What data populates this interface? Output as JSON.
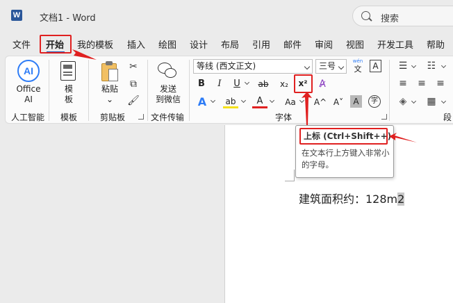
{
  "window": {
    "title": "文档1  -  Word",
    "logo": "W"
  },
  "search": {
    "label": "搜索"
  },
  "tabs": [
    "文件",
    "开始",
    "我的模板",
    "插入",
    "绘图",
    "设计",
    "布局",
    "引用",
    "邮件",
    "审阅",
    "视图",
    "开发工具",
    "帮助"
  ],
  "ribbon": {
    "office_ai": {
      "icon_text": "AI",
      "label_line1": "Office",
      "label_line2": "AI",
      "group": "人工智能"
    },
    "template": {
      "label_line1": "模",
      "label_line2": "板",
      "group": "模板"
    },
    "clipboard": {
      "paste_line1": "粘贴",
      "paste_arrow": "⌄",
      "group": "剪贴板"
    },
    "transfer": {
      "label_line1": "发送",
      "label_line2": "到微信",
      "group": "文件传输"
    },
    "font": {
      "font_name": "等线 (西文正文)",
      "font_size": "三号",
      "wen_top": "wén",
      "wen_char": "文",
      "bold": "B",
      "italic": "I",
      "underline": "U",
      "strike": "ab",
      "subscript": "x₂",
      "superscript": "x²",
      "text_effect": "A",
      "highlight": "ab",
      "font_color": "A",
      "change_case": "Aa",
      "grow": "A^",
      "shrink": "A˅",
      "clear": "A",
      "shade": "A",
      "enclose": "字",
      "group": "字体"
    },
    "paragraph": {
      "group": "段"
    }
  },
  "tooltip": {
    "title": "上标 (Ctrl+Shift++)",
    "desc": "在文本行上方键入非常小的字母。"
  },
  "document": {
    "text_before": "建筑面积约：128m",
    "selected": "2"
  },
  "colors": {
    "accent_red": "#e02020",
    "word_blue": "#2b579a"
  }
}
